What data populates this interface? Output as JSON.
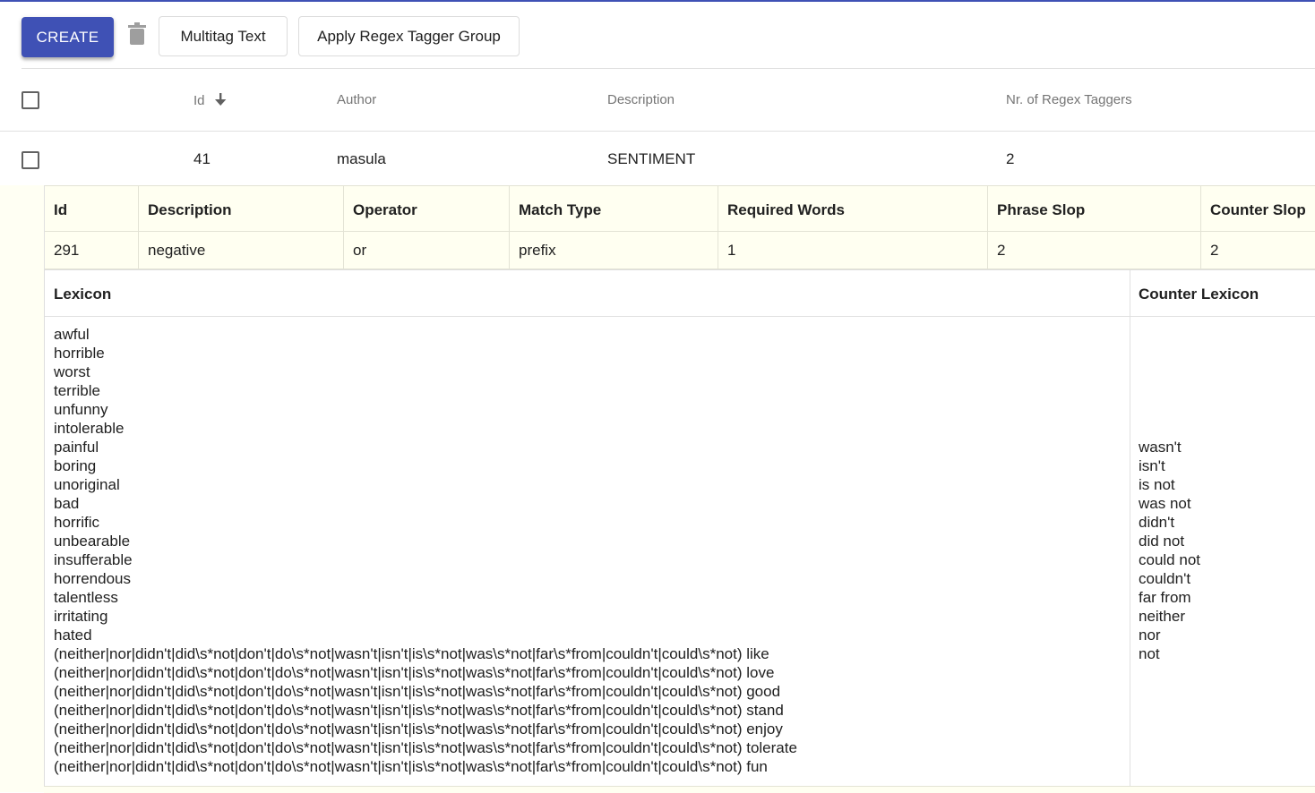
{
  "toolbar": {
    "create_label": "CREATE",
    "multitag_label": "Multitag Text",
    "regex_label": "Apply Regex Tagger Group",
    "accent_color": "#3f51b5"
  },
  "table": {
    "headers": {
      "id": "Id",
      "author": "Author",
      "description": "Description",
      "nr_regex": "Nr. of Regex Taggers"
    },
    "row": {
      "id": "41",
      "author": "masula",
      "description": "SENTIMENT",
      "nr_regex": "2"
    }
  },
  "sub_table": {
    "headers": {
      "id": "Id",
      "description": "Description",
      "operator": "Operator",
      "match_type": "Match Type",
      "required_words": "Required Words",
      "phrase_slop": "Phrase Slop",
      "counter_slop": "Counter Slop"
    },
    "row": {
      "id": "291",
      "description": "negative",
      "operator": "or",
      "match_type": "prefix",
      "required_words": "1",
      "phrase_slop": "2",
      "counter_slop": "2"
    }
  },
  "lexicon": {
    "title": "Lexicon",
    "items": [
      "awful",
      "horrible",
      "worst",
      "terrible",
      "unfunny",
      "intolerable",
      "painful",
      "boring",
      "unoriginal",
      "bad",
      "horrific",
      "unbearable",
      "insufferable",
      "horrendous",
      "talentless",
      "irritating",
      "hated",
      "(neither|nor|didn't|did\\s*not|don't|do\\s*not|wasn't|isn't|is\\s*not|was\\s*not|far\\s*from|couldn't|could\\s*not) like",
      "(neither|nor|didn't|did\\s*not|don't|do\\s*not|wasn't|isn't|is\\s*not|was\\s*not|far\\s*from|couldn't|could\\s*not) love",
      "(neither|nor|didn't|did\\s*not|don't|do\\s*not|wasn't|isn't|is\\s*not|was\\s*not|far\\s*from|couldn't|could\\s*not) good",
      "(neither|nor|didn't|did\\s*not|don't|do\\s*not|wasn't|isn't|is\\s*not|was\\s*not|far\\s*from|couldn't|could\\s*not) stand",
      "(neither|nor|didn't|did\\s*not|don't|do\\s*not|wasn't|isn't|is\\s*not|was\\s*not|far\\s*from|couldn't|could\\s*not) enjoy",
      "(neither|nor|didn't|did\\s*not|don't|do\\s*not|wasn't|isn't|is\\s*not|was\\s*not|far\\s*from|couldn't|could\\s*not) tolerate",
      "(neither|nor|didn't|did\\s*not|don't|do\\s*not|wasn't|isn't|is\\s*not|was\\s*not|far\\s*from|couldn't|could\\s*not) fun"
    ]
  },
  "counter_lexicon": {
    "title": "Counter Lexicon",
    "items": [
      "wasn't",
      "isn't",
      "is not",
      "was not",
      "didn't",
      "did not",
      "could not",
      "couldn't",
      "far from",
      "neither",
      "nor",
      "not"
    ]
  }
}
